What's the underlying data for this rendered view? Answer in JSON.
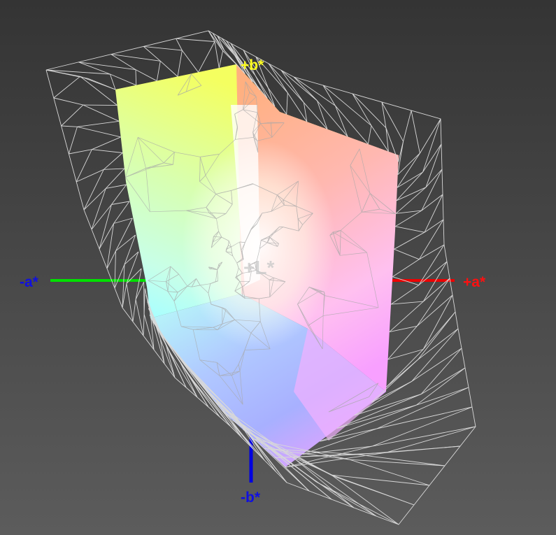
{
  "axes": {
    "minus_a": {
      "label": "-a*",
      "color": "#1010e0",
      "line_color": "#00e000"
    },
    "plus_a": {
      "label": "+a*",
      "color": "#ff1010",
      "line_color": "#ee0000"
    },
    "plus_b": {
      "label": "+b*",
      "color": "#ffff20"
    },
    "minus_b": {
      "label": "-b*",
      "color": "#1010e0",
      "line_color": "#0000e0"
    },
    "plus_l": {
      "label": "+L*",
      "color": "#c8c8c8"
    }
  },
  "colors": {
    "background_top": "#343434",
    "background_bottom": "#5c5c5c",
    "wireframe": "#d8d8d8"
  }
}
